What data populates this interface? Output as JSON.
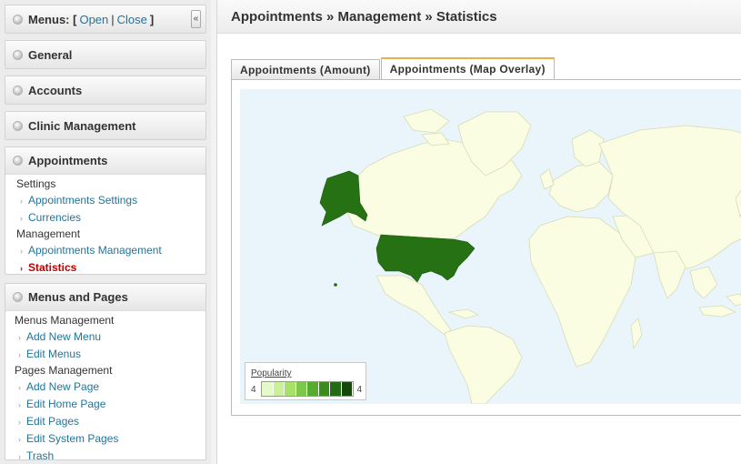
{
  "sidebar": {
    "menus": {
      "label": "Menus: [",
      "open": "Open",
      "sep": "|",
      "close": "Close",
      "end": "]",
      "collapse_glyph": "«"
    },
    "panels": {
      "general": "General",
      "accounts": "Accounts",
      "clinic": "Clinic Management",
      "appointments": {
        "title": "Appointments",
        "settings_label": "Settings",
        "settings_items": [
          "Appointments Settings",
          "Currencies"
        ],
        "management_label": "Management",
        "management_items": [
          "Appointments Management",
          "Statistics"
        ]
      },
      "menus_pages": {
        "title": "Menus and Pages",
        "menus_label": "Menus Management",
        "menus_items": [
          "Add New Menu",
          "Edit Menus"
        ],
        "pages_label": "Pages Management",
        "pages_items": [
          "Add New Page",
          "Edit Home Page",
          "Edit Pages",
          "Edit System Pages",
          "Trash"
        ]
      }
    }
  },
  "header": {
    "title": "Appointments » Management » Statistics"
  },
  "tabs": [
    "Appointments (Amount)",
    "Appointments (Map Overlay)"
  ],
  "active_tab": 1,
  "map": {
    "ocean_color": "#eaf4fb",
    "land_color": "#fbfde3",
    "border_color": "#d6dcb4",
    "highlight_color": "#267114",
    "highlighted_country": "United States",
    "legend": {
      "title": "Popularity",
      "min": "4",
      "max": "4",
      "colors": [
        "#e5fbc7",
        "#c8f19a",
        "#a8e06c",
        "#7cc84a",
        "#56ab30",
        "#3a8c1d",
        "#256b13",
        "#16480c"
      ]
    }
  }
}
